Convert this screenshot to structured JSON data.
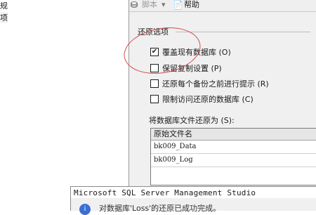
{
  "left_pane": {
    "items": [
      {
        "label": "规"
      },
      {
        "label": "项"
      }
    ]
  },
  "toolbar": {
    "script_label": "脚本",
    "script_arrow": "▾",
    "help_label": "帮助"
  },
  "restore_options": {
    "title": "还原选项",
    "options": [
      {
        "label": "覆盖现有数据库 (O)",
        "checked": true
      },
      {
        "label": "保留复制设置 (P)",
        "checked": false
      },
      {
        "label": "还原每个备份之前进行提示 (R)",
        "checked": false
      },
      {
        "label": "限制访问还原的数据库 (C)",
        "checked": false
      }
    ],
    "check_glyph": "✔"
  },
  "restore_as": {
    "label": "将数据库文件还原为 (S):",
    "column_header": "原始文件名",
    "rows": [
      "bk009_Data",
      "bk009_Log"
    ]
  },
  "message_box": {
    "title": "Microsoft SQL Server Management Studio",
    "body": "对数据库'Loss'的还原已成功完成。",
    "icon": "i"
  },
  "colors": {
    "annotation": "#d14b4b",
    "panel_bg": "#f0f0f0"
  }
}
